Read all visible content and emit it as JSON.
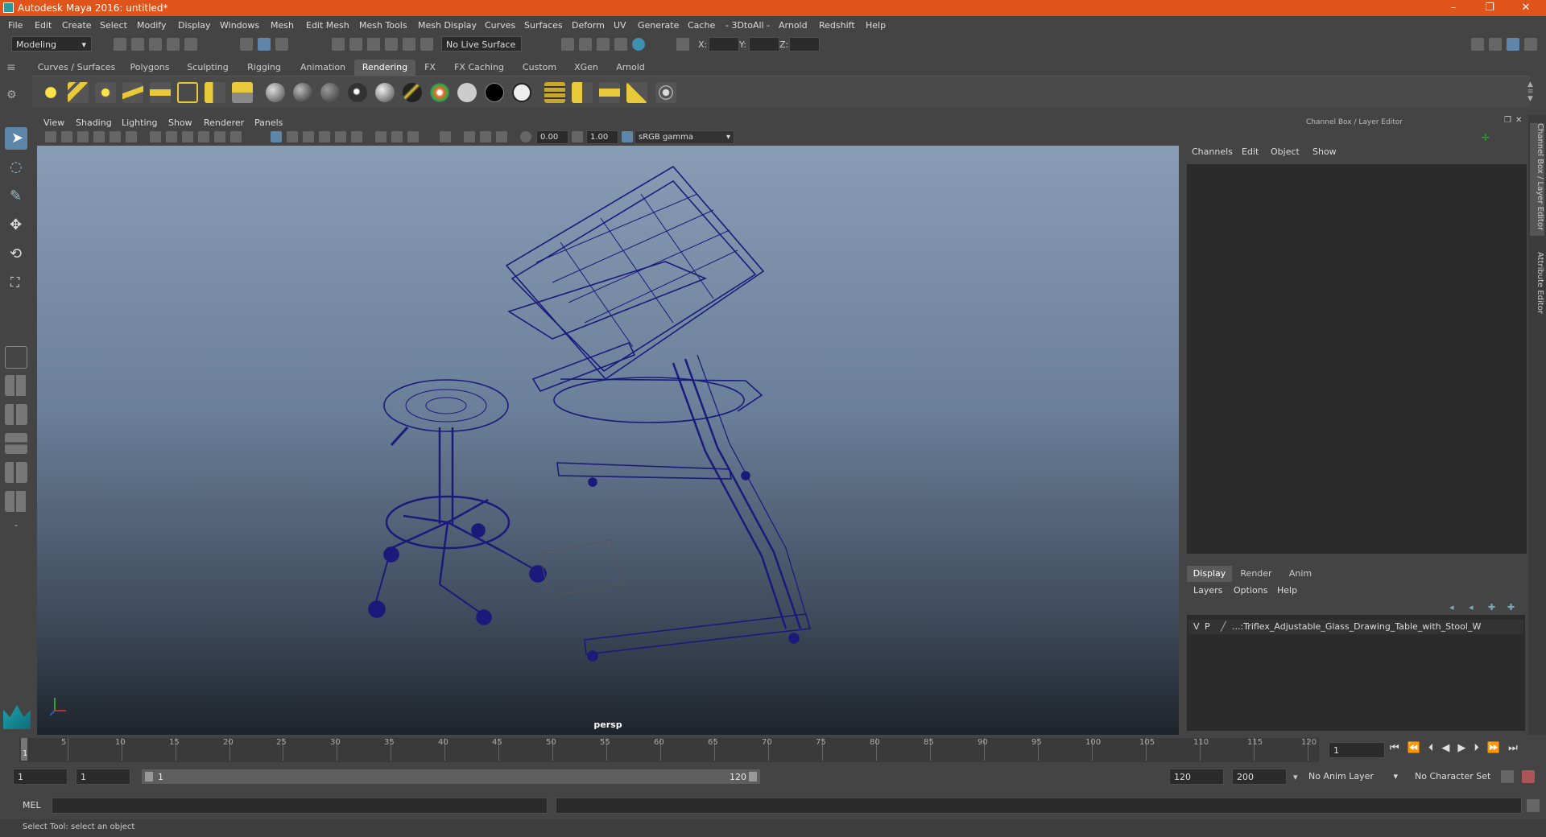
{
  "window": {
    "title": "Autodesk Maya 2016: untitled*"
  },
  "menubar": [
    "File",
    "Edit",
    "Create",
    "Select",
    "Modify",
    "Display",
    "Windows",
    "Mesh",
    "Edit Mesh",
    "Mesh Tools",
    "Mesh Display",
    "Curves",
    "Surfaces",
    "Deform",
    "UV",
    "Generate",
    "Cache",
    "- 3DtoAll -",
    "Arnold",
    "Redshift",
    "Help"
  ],
  "statusline": {
    "mode": "Modeling",
    "live_surface": "No Live Surface",
    "x_label": "X:",
    "y_label": "Y:",
    "z_label": "Z:"
  },
  "shelf": {
    "tabs": [
      "Curves / Surfaces",
      "Polygons",
      "Sculpting",
      "Rigging",
      "Animation",
      "Rendering",
      "FX",
      "FX Caching",
      "Custom",
      "XGen",
      "Arnold"
    ],
    "active_tab": "Rendering"
  },
  "viewport": {
    "menu": [
      "View",
      "Shading",
      "Lighting",
      "Show",
      "Renderer",
      "Panels"
    ],
    "exposure": "0.00",
    "gamma": "1.00",
    "color_space": "sRGB gamma",
    "camera_label": "persp",
    "wire_color": "#1a1a7a"
  },
  "channel_box": {
    "title": "Channel Box / Layer Editor",
    "menu": [
      "Channels",
      "Edit",
      "Object",
      "Show"
    ]
  },
  "layer_editor": {
    "tabs": [
      "Display",
      "Render",
      "Anim"
    ],
    "active_tab": "Display",
    "menu": [
      "Layers",
      "Options",
      "Help"
    ],
    "layer": {
      "v": "V",
      "p": "P",
      "name": "...:Triflex_Adjustable_Glass_Drawing_Table_with_Stool_W"
    }
  },
  "side_tabs": [
    "Channel Box / Layer Editor",
    "Attribute Editor"
  ],
  "timeline": {
    "ticks": [
      "5",
      "10",
      "15",
      "20",
      "25",
      "30",
      "35",
      "40",
      "45",
      "50",
      "55",
      "60",
      "65",
      "70",
      "75",
      "80",
      "85",
      "90",
      "95",
      "100",
      "105",
      "110",
      "115",
      "120"
    ],
    "first": "1",
    "current_frame": "1"
  },
  "range": {
    "start": "1",
    "start_inner": "1",
    "slider_start": "1",
    "slider_end": "120",
    "end_inner": "120",
    "end": "200",
    "anim_layer": "No Anim Layer",
    "character_set": "No Character Set"
  },
  "command": {
    "label": "MEL"
  },
  "help_line": "Select Tool: select an object"
}
